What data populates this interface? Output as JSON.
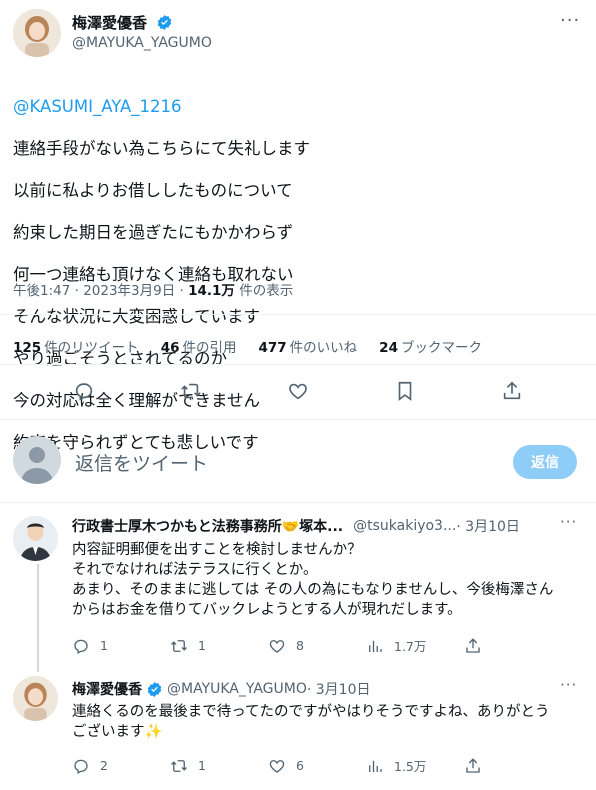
{
  "main_tweet": {
    "author_name": "梅澤愛優香",
    "author_handle": "@MAYUKA_YAGUMO",
    "mention": "@KASUMI_AYA_1216",
    "lines": [
      "連絡手段がない為こちらにて失礼します",
      "以前に私よりお借ししたものについて",
      "約束した期日を過ぎたにもかかわらず",
      "何一つ連絡も頂けなく連絡も取れない",
      "そんな状況に大変困惑しています",
      "やり過ごそうとされてるのか",
      "今の対応は全く理解ができません",
      "約束を守られずとても悲しいです"
    ],
    "timestamp": "午後1:47 · 2023年3月9日 · ",
    "views_count": "14.1万",
    "views_label": " 件の表示",
    "stats": {
      "retweets_count": "125",
      "retweets_label": "件のリツイート",
      "quotes_count": "46",
      "quotes_label": "件の引用",
      "likes_count": "477",
      "likes_label": "件のいいね",
      "bookmarks_count": "24",
      "bookmarks_label": "ブックマーク"
    }
  },
  "reply_box": {
    "placeholder": "返信をツイート",
    "button_label": "返信"
  },
  "replies": [
    {
      "author_name": "行政書士厚木つかもと法務事務所🤝塚本...",
      "author_handle": "@tsukakiyo3...",
      "date": " · 3月10日",
      "text": "内容証明郵便を出すことを検討しませんか？\nそれでなければ法テラスに行くとか。\nあまり、そのままに逃しては その人の為にもなりませんし、今後梅澤さん\nからはお金を借りてバックレようとする人が現れだします。",
      "replies": "1",
      "retweets": "1",
      "likes": "8",
      "views": "1.7万"
    },
    {
      "author_name": "梅澤愛優香",
      "author_handle": "@MAYUKA_YAGUMO",
      "date": " · 3月10日",
      "text": "連絡くるのを最後まで待ってたのですがやはりそうですよね、ありがとう\nございます✨",
      "replies": "2",
      "retweets": "1",
      "likes": "6",
      "views": "1.5万"
    }
  ],
  "colors": {
    "accent": "#1d9bf0",
    "secondary": "#536471",
    "reply_button": "#8ecdf8"
  }
}
